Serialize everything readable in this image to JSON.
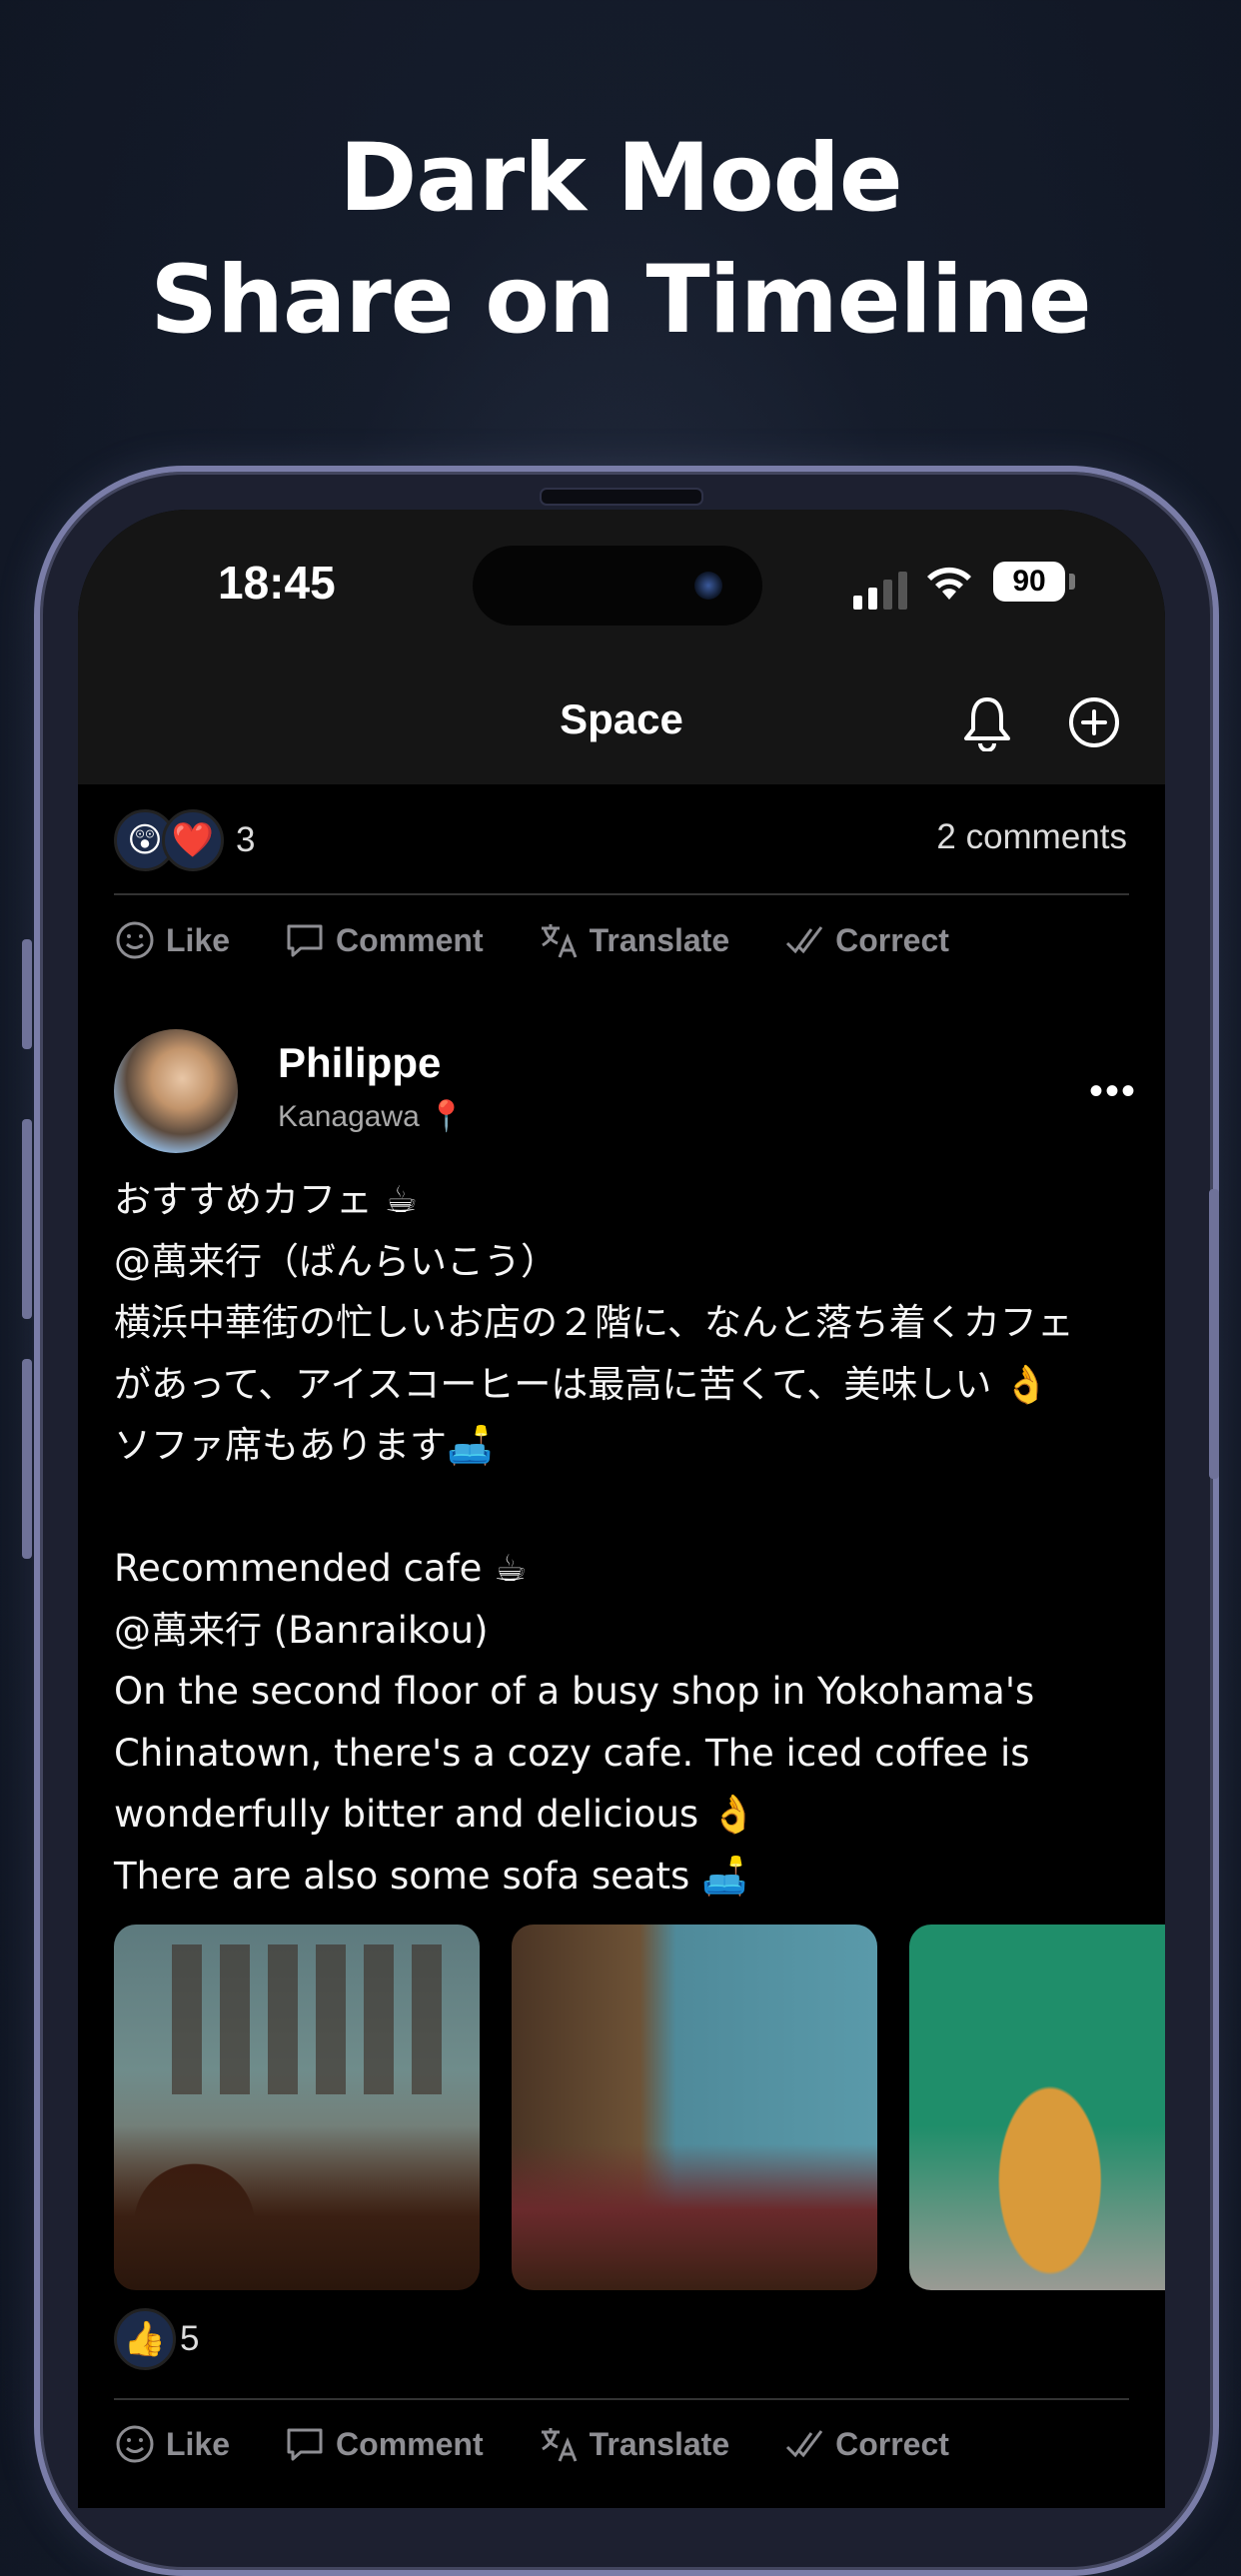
{
  "headline": {
    "line1": "Dark Mode",
    "line2": "Share on Timeline"
  },
  "status_bar": {
    "time": "18:45",
    "battery": "90"
  },
  "nav": {
    "title": "Space"
  },
  "prev_post": {
    "reaction_emojis": [
      "😲",
      "❤️"
    ],
    "reaction_count": "3",
    "comments": "2 comments"
  },
  "actions": {
    "like": "Like",
    "comment": "Comment",
    "translate": "Translate",
    "correct": "Correct"
  },
  "post": {
    "author": "Philippe",
    "location": "Kanagawa 📍",
    "more": "•••",
    "body": "おすすめカフェ ☕\n@萬来行（ばんらいこう）\n横浜中華街の忙しいお店の２階に、なんと落ち着くカフェ\nがあって、アイスコーヒーは最高に苦くて、美味しい 👌\nソファ席もあります🛋️\n\nRecommended cafe ☕\n@萬来行 (Banraikou)\nOn the second floor of a busy shop in Yokohama's\nChinatown, there's a cozy cafe. The iced coffee is\nwonderfully bitter and delicious 👌\nThere are also some sofa seats 🛋️",
    "reaction_emoji": "👍",
    "reaction_count": "5"
  },
  "colors": {
    "background": "#151c2b",
    "screen": "#000000",
    "bar": "#151515",
    "muted": "#8e8e93"
  }
}
